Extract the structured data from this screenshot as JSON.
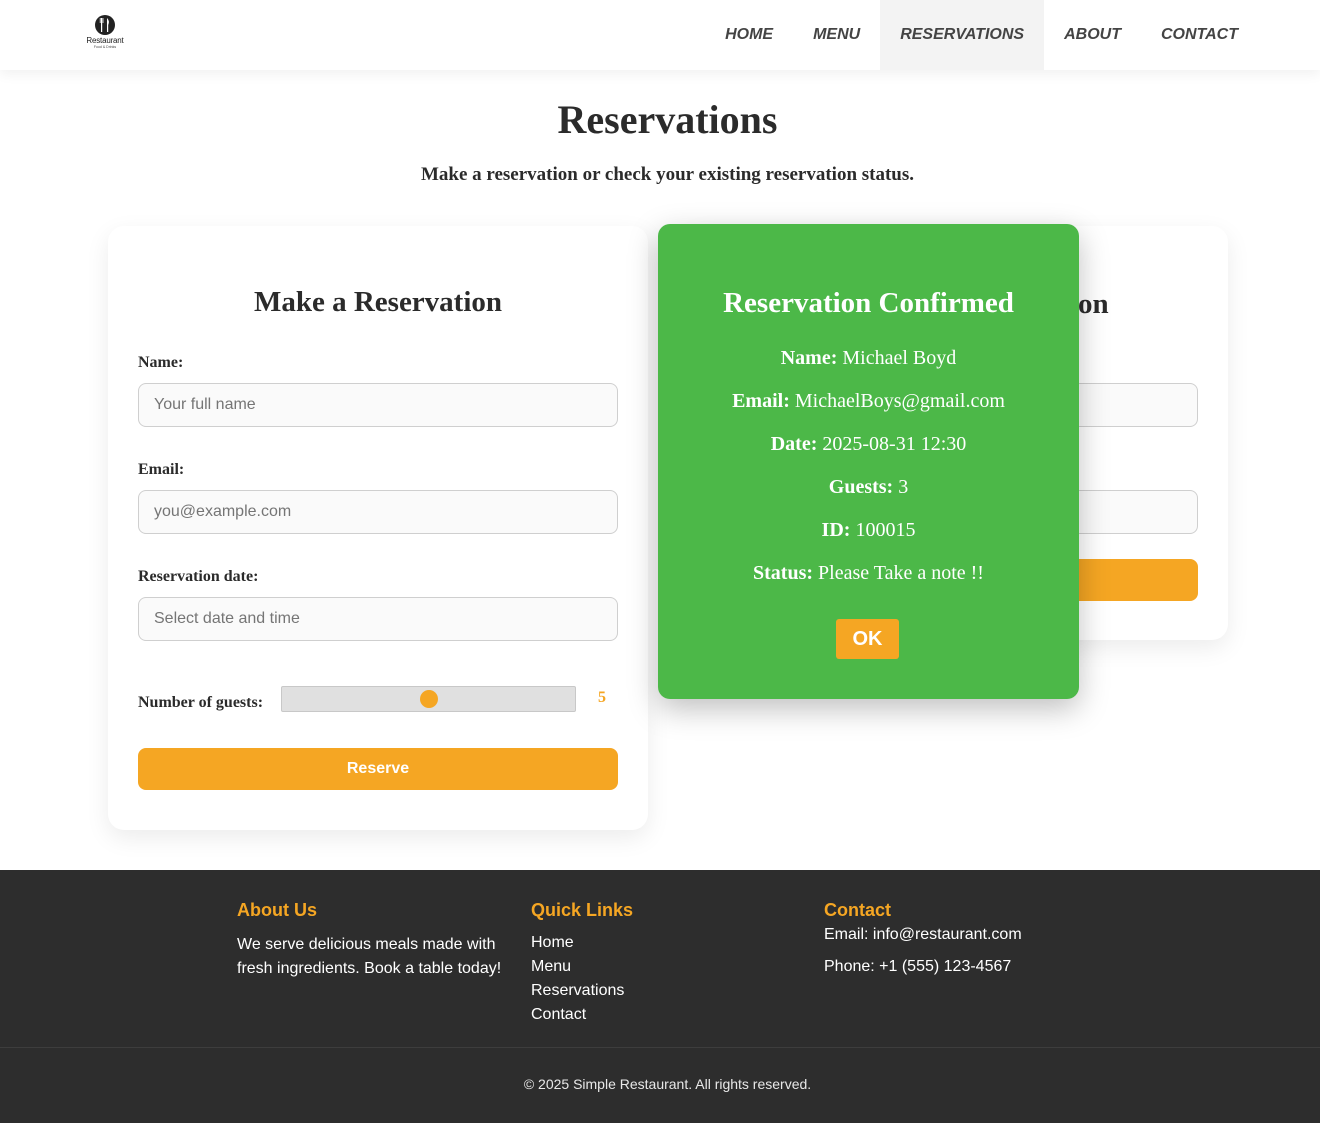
{
  "header": {
    "logo_text": "Restaurant",
    "logo_sub": "Food & Drinks",
    "nav": [
      "HOME",
      "MENU",
      "RESERVATIONS",
      "ABOUT",
      "CONTACT"
    ],
    "active_nav": "RESERVATIONS"
  },
  "page": {
    "title": "Reservations",
    "subtitle": "Make a reservation or check your existing reservation status."
  },
  "reservation_form": {
    "title": "Make a Reservation",
    "name_label": "Name:",
    "name_placeholder": "Your full name",
    "email_label": "Email:",
    "email_placeholder": "you@example.com",
    "date_label": "Reservation date:",
    "date_placeholder": "Select date and time",
    "guests_label": "Number of guests:",
    "guests_value": "5",
    "guests_slider_fraction": 0.5,
    "submit_label": "Reserve"
  },
  "check_form": {
    "title_visible_fragment": "on"
  },
  "modal": {
    "title": "Reservation Confirmed",
    "rows": [
      {
        "label": "Name:",
        "value": "Michael Boyd"
      },
      {
        "label": "Email:",
        "value": "MichaelBoys@gmail.com"
      },
      {
        "label": "Date:",
        "value": "2025-08-31 12:30"
      },
      {
        "label": "Guests:",
        "value": "3"
      },
      {
        "label": "ID:",
        "value": "100015"
      },
      {
        "label": "Status:",
        "value": "Please Take a note !!"
      }
    ],
    "ok_label": "OK"
  },
  "footer": {
    "about_title": "About Us",
    "about_text": "We serve delicious meals made with fresh ingredients. Book a table today!",
    "links_title": "Quick Links",
    "links": [
      "Home",
      "Menu",
      "Reservations",
      "Contact"
    ],
    "contact_title": "Contact",
    "email": "Email: info@restaurant.com",
    "phone": "Phone: +1 (555) 123-4567",
    "copyright": "© 2025 Simple Restaurant. All rights reserved."
  },
  "colors": {
    "accent": "#f5a623",
    "modal_bg": "#4cb848",
    "footer_bg": "#2d2d2d"
  }
}
